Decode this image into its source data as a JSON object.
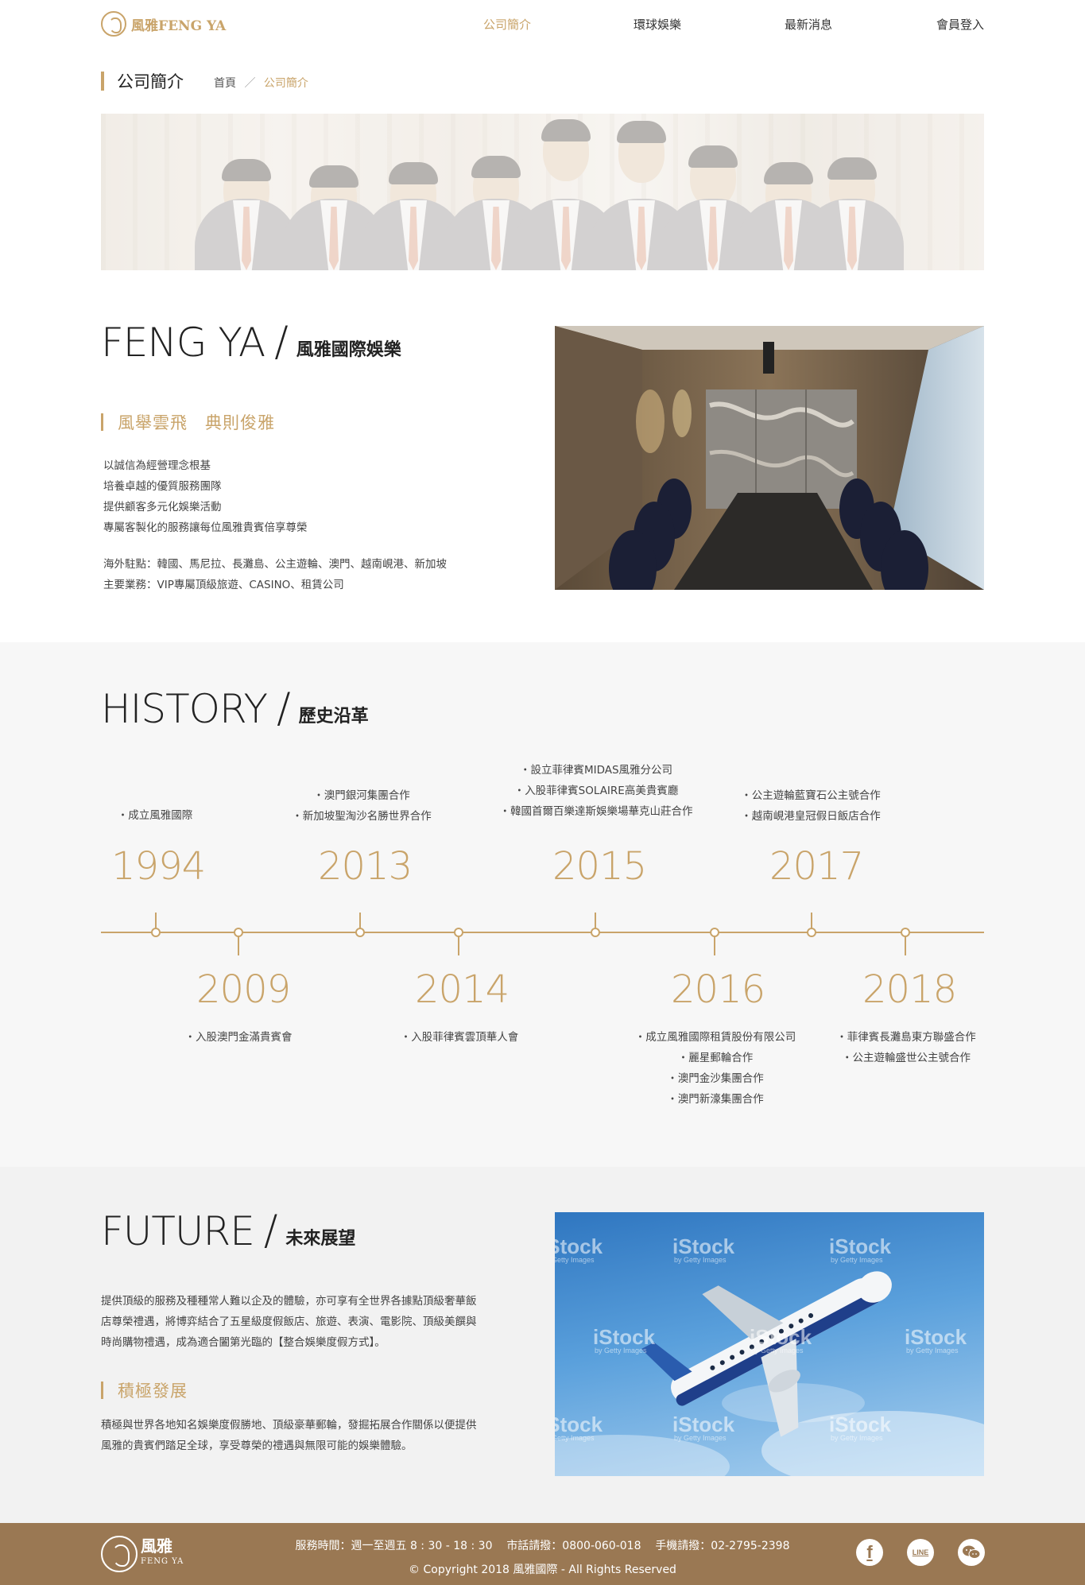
{
  "brand": {
    "logo_text": "風雅FENG YA"
  },
  "nav": {
    "items": [
      {
        "label": "公司簡介",
        "active": true
      },
      {
        "label": "環球娛樂",
        "active": false
      },
      {
        "label": "最新消息",
        "active": false
      },
      {
        "label": "會員登入",
        "active": false
      }
    ]
  },
  "page": {
    "title": "公司簡介",
    "breadcrumb": {
      "home": "首頁",
      "separator": "／",
      "current": "公司簡介"
    }
  },
  "about": {
    "heading_en": "FENG YA",
    "heading_zh": "風雅國際娛樂",
    "slogan": "風舉雲飛　典則俊雅",
    "lines": [
      "以誠信為經營理念根基",
      "培養卓越的優質服務團隊",
      "提供顧客多元化娛樂活動",
      "專屬客製化的服務讓每位風雅貴賓倍享尊榮"
    ],
    "locations": "海外駐點：韓國、馬尼拉、長灘島、公主遊輪、澳門、越南峴港、新加坡",
    "business": "主要業務：VIP專屬頂級旅遊、CASINO、租賃公司"
  },
  "history": {
    "heading_en": "HISTORY",
    "heading_zh": "歷史沿革",
    "top": [
      {
        "year": "1994",
        "events": [
          "・成立風雅國際"
        ]
      },
      {
        "year": "2013",
        "events": [
          "・澳門銀河集團合作",
          "・新加坡聖淘沙名勝世界合作"
        ]
      },
      {
        "year": "2015",
        "events": [
          "・設立菲律賓MIDAS風雅分公司",
          "・入股菲律賓SOLAIRE高美貴賓廳",
          "・韓國首爾百樂達斯娛樂場華克山莊合作"
        ]
      },
      {
        "year": "2017",
        "events": [
          "・公主遊輪藍寶石公主號合作",
          "・越南峴港皇冠假日飯店合作"
        ]
      }
    ],
    "bottom": [
      {
        "year": "2009",
        "events": [
          "・入股澳門金滿貴賓會"
        ]
      },
      {
        "year": "2014",
        "events": [
          "・入股菲律賓雲頂華人會"
        ]
      },
      {
        "year": "2016",
        "events": [
          "・成立風雅國際租賃股份有限公司",
          "・麗星郵輪合作",
          "・澳門金沙集團合作",
          "・澳門新濠集團合作"
        ]
      },
      {
        "year": "2018",
        "events": [
          "・菲律賓長灘島東方聯盛合作",
          "・公主遊輪盛世公主號合作"
        ]
      }
    ]
  },
  "future": {
    "heading_en": "FUTURE",
    "heading_zh": "未來展望",
    "paragraph": [
      "提供頂級的服務及種種常人難以企及的體驗，亦可享有全世界各據點頂級奢華飯",
      "店尊榮禮遇，將博弈結合了五星級度假飯店、旅遊、表演、電影院、頂級美饌與",
      "時尚購物禮遇，成為適合闔第光臨的【整合娛樂度假方式】。"
    ],
    "subheading": "積極發展",
    "paragraph2": [
      "積極與世界各地知名娛樂度假勝地、頂級豪華郵輪，發掘拓展合作關係以便提供",
      "風雅的貴賓們踏足全球，享受尊榮的禮遇與無限可能的娛樂體驗。"
    ],
    "watermark": "iStock",
    "watermark_sub": "by Getty Images"
  },
  "footer": {
    "logo_name": "風雅",
    "logo_sub": "FENG YA",
    "service_hours": "服務時間：週一至週五 8 : 30 - 18 : 30",
    "phone": "市話請撥：0800-060-018",
    "mobile": "手機請撥：02-2795-2398",
    "copyright": "© Copyright 2018 風雅國際 - All Rights Reserved",
    "social": [
      {
        "icon": "facebook-icon",
        "label": "f"
      },
      {
        "icon": "line-icon",
        "label": "LINE"
      },
      {
        "icon": "wechat-icon",
        "label": "wechat"
      }
    ]
  },
  "colors": {
    "accent": "#c9a46a",
    "footer_bg": "#9a7853",
    "history_bg": "#f7f7f7",
    "future_bg": "#f2f2f2"
  }
}
